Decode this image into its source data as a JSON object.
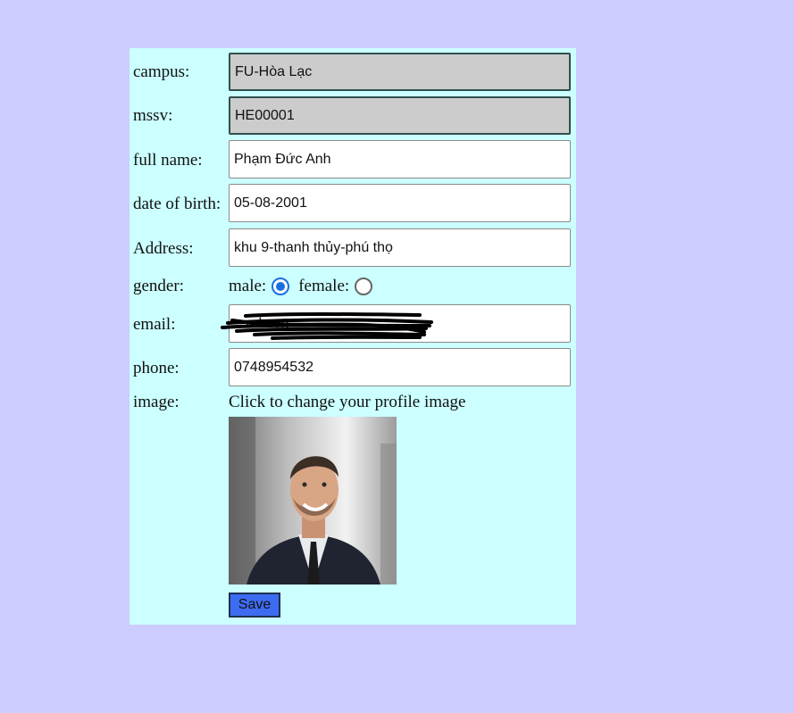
{
  "form": {
    "campus": {
      "label": "campus:",
      "value": "FU-Hòa Lạc"
    },
    "mssv": {
      "label": "mssv:",
      "value": "HE00001"
    },
    "full_name": {
      "label": "full name:",
      "value": "Phạm Đức Anh"
    },
    "dob": {
      "label": "date of birth:",
      "value": "05-08-2001"
    },
    "address": {
      "label": "Address:",
      "value": "khu 9-thanh thủy-phú thọ"
    },
    "gender": {
      "label": "gender:",
      "male_label": "male:",
      "female_label": "female:",
      "selected": "male"
    },
    "email": {
      "label": "email:",
      "value": "...edu.vn",
      "redacted": true
    },
    "phone": {
      "label": "phone:",
      "value": "0748954532"
    },
    "image": {
      "label": "image:",
      "change_text": "Click to change your profile image"
    },
    "save_label": "Save"
  },
  "colors": {
    "page_bg": "#ccccff",
    "panel_bg": "#ccffff",
    "readonly_bg": "#cccccc",
    "save_bg": "#3d6cf2",
    "radio_accent": "#1a6fe0"
  }
}
